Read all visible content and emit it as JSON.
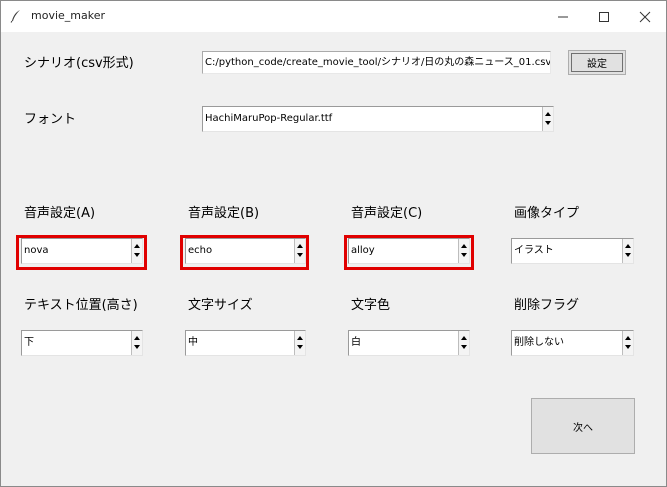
{
  "window": {
    "title": "movie_maker",
    "icon": "feather-icon"
  },
  "scenario": {
    "label": "シナリオ(csv形式)",
    "value": "C:/python_code/create_movie_tool/シナリオ/日の丸の森ニュース_01.csv",
    "button": "設定"
  },
  "font": {
    "label": "フォント",
    "value": "HachiMaruPop-Regular.ttf"
  },
  "voice_a": {
    "label": "音声設定(A)",
    "value": "nova"
  },
  "voice_b": {
    "label": "音声設定(B)",
    "value": "echo"
  },
  "voice_c": {
    "label": "音声設定(C)",
    "value": "alloy"
  },
  "image_type": {
    "label": "画像タイプ",
    "value": "イラスト"
  },
  "text_position": {
    "label": "テキスト位置(高さ)",
    "value": "下"
  },
  "text_size": {
    "label": "文字サイズ",
    "value": "中"
  },
  "text_color": {
    "label": "文字色",
    "value": "白"
  },
  "delete_flag": {
    "label": "削除フラグ",
    "value": "削除しない"
  },
  "next_button": {
    "label": "次へ"
  },
  "colors": {
    "highlight": "#e00000",
    "background": "#f0f0f0"
  }
}
